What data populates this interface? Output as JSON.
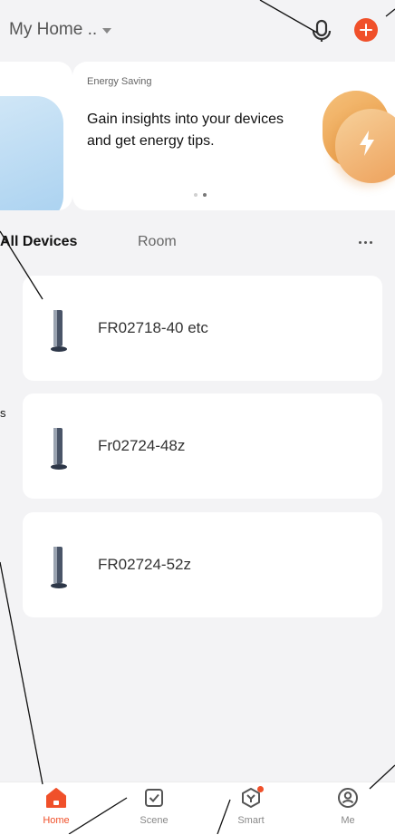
{
  "header": {
    "home_name": "My Home ..",
    "mic_icon": "microphone-icon",
    "add_icon": "plus-icon"
  },
  "banner": {
    "kicker": "Energy Saving",
    "headline": "Gain insights into your devices and get energy tips.",
    "page_count": 2,
    "active_page": 2
  },
  "device_tabs": {
    "all_label": "All Devices",
    "room_label": "Room"
  },
  "devices": [
    {
      "name": "FR02718-40 etc",
      "icon": "tower-heater-icon"
    },
    {
      "name": "Fr02724-48z",
      "icon": "tower-heater-icon"
    },
    {
      "name": "FR02724-52z",
      "icon": "tower-heater-icon"
    }
  ],
  "tabbar": {
    "items": [
      {
        "label": "Home",
        "icon": "home-icon"
      },
      {
        "label": "Scene",
        "icon": "checkbox-icon"
      },
      {
        "label": "Smart",
        "icon": "smart-cube-icon"
      },
      {
        "label": "Me",
        "icon": "profile-icon"
      }
    ]
  },
  "edge_text": "s",
  "colors": {
    "accent": "#f0502a",
    "background": "#f3f3f5",
    "card": "#ffffff"
  }
}
